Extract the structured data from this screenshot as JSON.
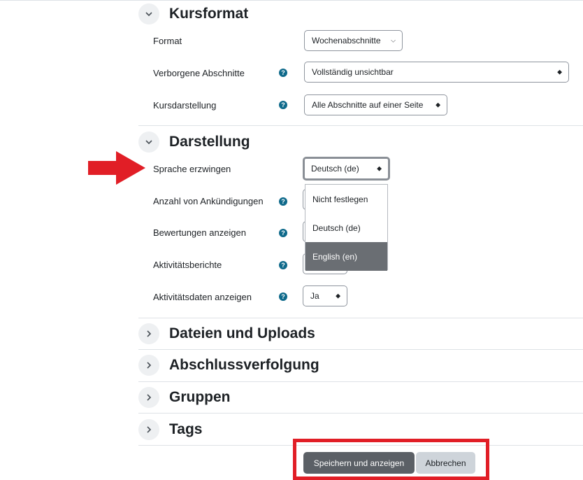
{
  "sections": {
    "kursformat": {
      "title": "Kursformat",
      "format_label": "Format",
      "format_value": "Wochenabschnitte",
      "hidden_label": "Verborgene Abschnitte",
      "hidden_value": "Vollständig unsichtbar",
      "layout_label": "Kursdarstellung",
      "layout_value": "Alle Abschnitte auf einer Seite"
    },
    "darstellung": {
      "title": "Darstellung",
      "lang_label": "Sprache erzwingen",
      "lang_value": "Deutsch (de)",
      "lang_options": [
        "Nicht festlegen",
        "Deutsch (de)",
        "English (en)"
      ],
      "announce_label": "Anzahl von Ankündigungen",
      "grades_label": "Bewertungen anzeigen",
      "reports_label": "Aktivitätsberichte",
      "activitydates_label": "Aktivitätsdaten anzeigen",
      "activitydates_value": "Ja"
    },
    "uploads": {
      "title": "Dateien und Uploads"
    },
    "completion": {
      "title": "Abschlussverfolgung"
    },
    "groups": {
      "title": "Gruppen"
    },
    "tags": {
      "title": "Tags"
    }
  },
  "help_glyph": "?",
  "buttons": {
    "save_label": "Speichern und anzeigen",
    "cancel_label": "Abbrechen"
  },
  "icons": {
    "expanded": "chevron-down-icon",
    "collapsed": "chevron-right-icon",
    "help": "help-icon",
    "annotation": "red-arrow-icon"
  },
  "colors": {
    "accent": "#0f6a8b",
    "annotation_red": "#e11e26",
    "primary_button": "#5b6066",
    "selected_option": "#6a6e73"
  }
}
